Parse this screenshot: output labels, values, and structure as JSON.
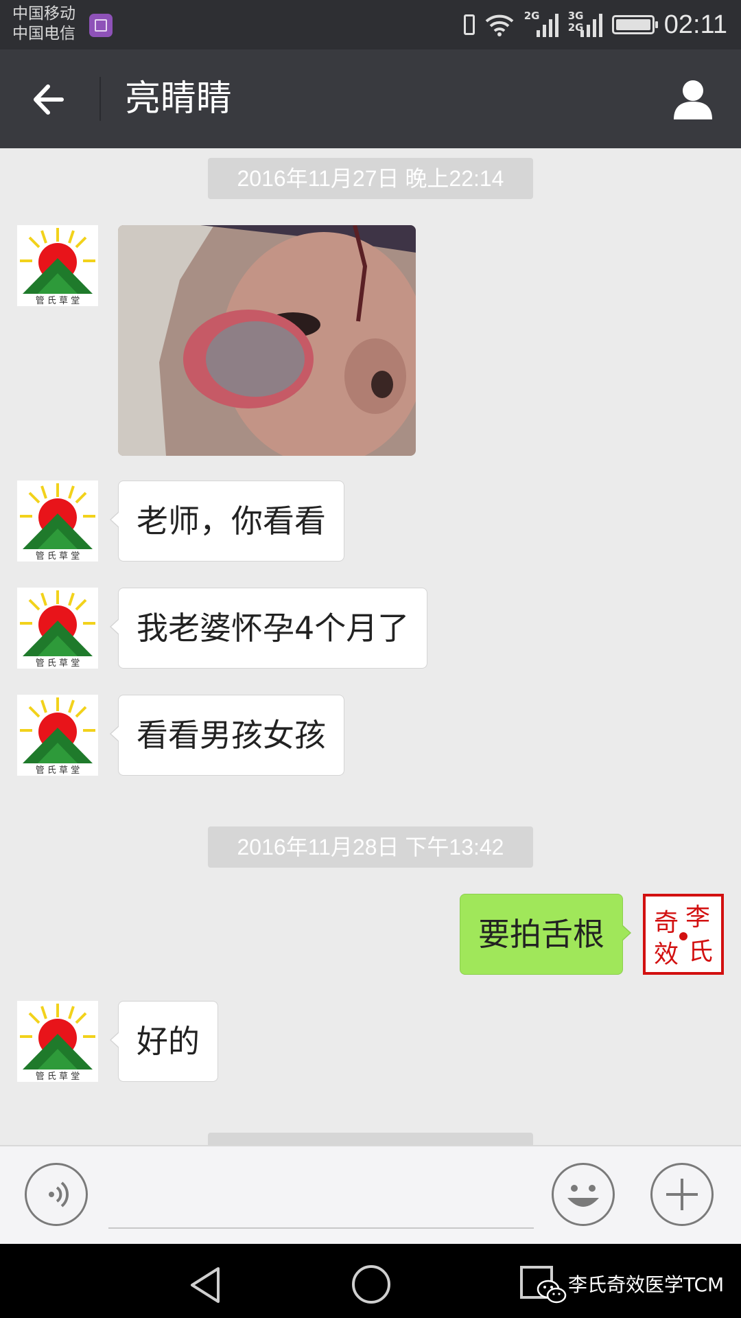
{
  "status_bar": {
    "carrier_1": "中国移动",
    "carrier_2": "中国电信",
    "network_1": "2G",
    "network_2_top": "3G",
    "network_2_bottom": "2G",
    "time": "02:11"
  },
  "header": {
    "title": "亮睛睛"
  },
  "messages": [
    {
      "type": "timestamp",
      "text": "2016年11月27日 晚上22:14"
    },
    {
      "type": "image",
      "from": "other",
      "description_icon": "photo"
    },
    {
      "type": "text",
      "from": "other",
      "text": "老师，你看看"
    },
    {
      "type": "text",
      "from": "other",
      "text": "我老婆怀孕4个月了"
    },
    {
      "type": "text",
      "from": "other",
      "text": "看看男孩女孩"
    },
    {
      "type": "timestamp",
      "text": "2016年11月28日 下午13:42"
    },
    {
      "type": "text",
      "from": "me",
      "text": "要拍舌根"
    },
    {
      "type": "text",
      "from": "other",
      "text": "好的"
    }
  ],
  "avatars": {
    "other_logo_text": "管氏草堂",
    "me_seal_text": [
      "李",
      "氏",
      "奇",
      "效"
    ]
  },
  "watermark": "李氏奇效医学TCM",
  "colors": {
    "my_bubble": "#a0e75a",
    "title_bar": "#393a3f",
    "status_bar": "#2e2f33",
    "seal_red": "#d21010"
  }
}
